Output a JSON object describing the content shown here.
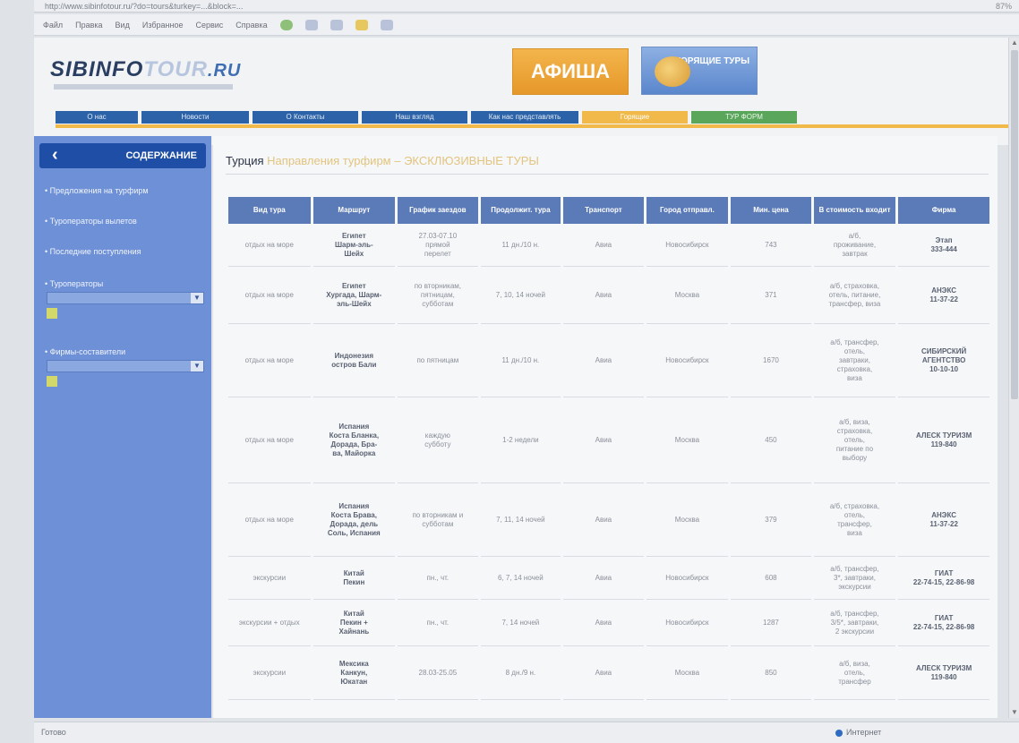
{
  "browser": {
    "address": "http://www.sibinfotour.ru/?do=tours&turkey=...&block=...",
    "zoom": "87%",
    "menu": [
      "Файл",
      "Правка",
      "Вид",
      "Избранное",
      "Сервис",
      "Справка"
    ],
    "status_left": "Готово",
    "status_right": "Интернет"
  },
  "site": {
    "logo_main": "SIBINFO",
    "logo_tour": "TOUR",
    "logo_ru": ".RU",
    "afisha_label": "АФИША",
    "hot_tours_label": "ГОРЯЩИЕ ТУРЫ",
    "nav": [
      "О нас",
      "Новости",
      "О Контакты",
      "Наш взгляд",
      "Как нас представлять",
      "Горящие",
      "ТУР ФОРМ"
    ]
  },
  "sidebar": {
    "title": "СОДЕРЖАНИЕ",
    "items": [
      "• Предложения на турфирм",
      "• Туроператоры вылетов",
      "• Последние поступления"
    ],
    "filter1_label": "• Туроператоры",
    "filter2_label": "• Фирмы-составители"
  },
  "main": {
    "breadcrumb": "Турция",
    "breadcrumb_sub": "Направления турфирм – ЭКСКЛЮЗИВНЫЕ ТУРЫ",
    "table": {
      "columns": [
        "Вид тура",
        "Маршрут",
        "График заездов",
        "Продолжит. тура",
        "Транспорт",
        "Город отправл.",
        "Мин. цена",
        "В стоимость входит",
        "Фирма"
      ],
      "rows": [
        [
          "отдых на море",
          "Египет\nШарм-эль-\nШейх",
          "27.03-07.10\nпрямой\nперелет",
          "11 дн./10 н.",
          "Авиа",
          "Новосибирск",
          "743",
          "а/б,\nпроживание,\nзавтрак",
          "Этап\n333-444"
        ],
        [
          "отдых на море",
          "Египет\nХургада, Шарм-\nэль-Шейх",
          "по вторникам,\nпятницам,\nсубботам",
          "7, 10, 14 ночей",
          "Авиа",
          "Москва",
          "371",
          "а/б, страховка,\nотель, питание,\nтрансфер, виза",
          "АНЭКС\n11-37-22"
        ],
        [
          "отдых на море",
          "Индонезия\nостров Бали",
          "по пятницам",
          "11 дн./10 н.",
          "Авиа",
          "Новосибирск",
          "1670",
          "а/б, трансфер,\nотель,\nзавтраки,\nстраховка,\nвиза",
          "СИБИРСКИЙ\nАГЕНТСТВО\n10-10-10"
        ],
        [
          "отдых на море",
          "Испания\nКоста Бланка,\nДорада, Бра-\nва, Майорка",
          "каждую\nсубботу",
          "1-2 недели",
          "Авиа",
          "Москва",
          "450",
          "а/б, виза,\nстраховка,\nотель,\nпитание по\nвыбору",
          "АЛЕСК ТУРИЗМ\n119-840"
        ],
        [
          "отдых на море",
          "Испания\nКоста Брава,\nДорада, дель\nСоль, Испания",
          "по вторникам и\nсубботам",
          "7, 11, 14 ночей",
          "Авиа",
          "Москва",
          "379",
          "а/б, страховка,\nотель,\nтрансфер,\nвиза",
          "АНЭКС\n11-37-22"
        ],
        [
          "экскурсии",
          "Китай\nПекин",
          "пн., чт.",
          "6, 7, 14 ночей",
          "Авиа",
          "Новосибирск",
          "608",
          "а/б, трансфер,\n3*, завтраки,\nэкскурсии",
          "ГИАТ\n22-74-15, 22-86-98"
        ],
        [
          "экскурсии + отдых",
          "Китай\nПекин +\nХайнань",
          "пн., чт.",
          "7, 14 ночей",
          "Авиа",
          "Новосибирск",
          "1287",
          "а/б, трансфер,\n3/5*, завтраки,\n2 экскурсии",
          "ГИАТ\n22-74-15, 22-86-98"
        ],
        [
          "экскурсии",
          "Мексика\nКанкун,\nЮкатан",
          "28.03-25.05",
          "8 дн./9 н.",
          "Авиа",
          "Москва",
          "850",
          "а/б, виза,\nотель,\nтрансфер",
          "АЛЕСК ТУРИЗМ\n119-840"
        ]
      ]
    }
  }
}
